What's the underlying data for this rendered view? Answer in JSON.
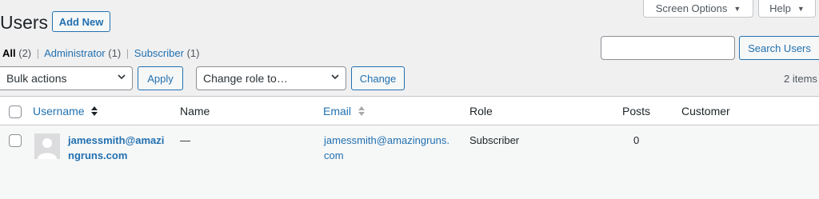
{
  "header": {
    "title": "Users",
    "add_new_label": "Add New",
    "screen_options_label": "Screen Options",
    "help_label": "Help"
  },
  "filters": {
    "all_label": "All",
    "all_count": "(2)",
    "administrator_label": "Administrator",
    "administrator_count": "(1)",
    "subscriber_label": "Subscriber",
    "subscriber_count": "(1)",
    "separator": "|"
  },
  "search": {
    "value": "",
    "button_label": "Search Users"
  },
  "bulk": {
    "bulk_actions_value": "Bulk actions",
    "apply_label": "Apply",
    "change_role_value": "Change role to…",
    "change_label": "Change"
  },
  "items_count": "2 items",
  "table": {
    "columns": {
      "username": "Username",
      "name": "Name",
      "email": "Email",
      "role": "Role",
      "posts": "Posts",
      "customer": "Customer"
    },
    "rows": [
      {
        "username_line1": "jamessmith@amazi",
        "username_line2": "ngruns.com",
        "name": "—",
        "email_line1": "jamessmith@amazingruns.",
        "email_line2": "com",
        "role": "Subscriber",
        "posts": "0",
        "customer": ""
      }
    ]
  },
  "icons": {
    "dropdown": "triangle-down-icon",
    "sort": "sort-arrows-icon",
    "select_chevron": "chevron-down-icon",
    "avatar": "default-avatar-icon"
  },
  "colors": {
    "link": "#2271b1",
    "background": "#f0f0f1",
    "border": "#c3c4c7"
  }
}
